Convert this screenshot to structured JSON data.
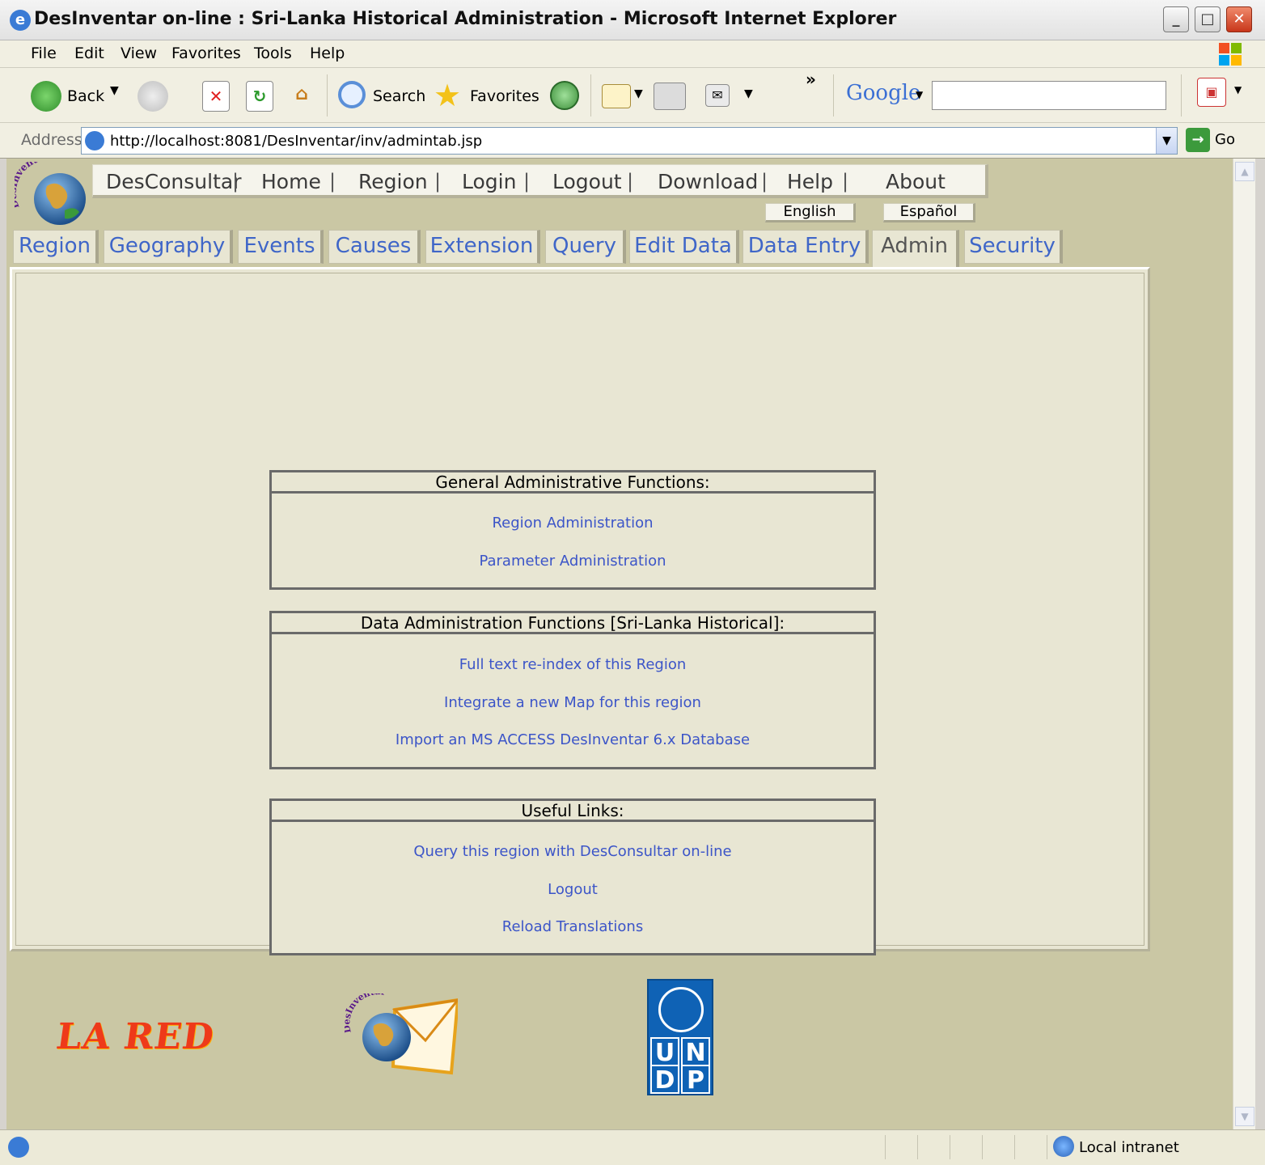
{
  "window": {
    "title": "DesInventar on-line : Sri-Lanka Historical Administration - Microsoft Internet Explorer"
  },
  "menu": [
    "File",
    "Edit",
    "View",
    "Favorites",
    "Tools",
    "Help"
  ],
  "toolbar": {
    "back": "Back",
    "search": "Search",
    "favorites": "Favorites",
    "google": "Google",
    "more": "»"
  },
  "address": {
    "label": "Address",
    "url": "http://localhost:8081/DesInventar/inv/admintab.jsp",
    "go": "Go"
  },
  "app": {
    "logo_text": "DesInventar",
    "topnav": [
      "DesConsultar",
      "Home",
      "Region",
      "Login",
      "Logout",
      "Download",
      "Help",
      "About"
    ],
    "languages": [
      "English",
      "Español"
    ],
    "tabs": [
      "Region",
      "Geography",
      "Events",
      "Causes",
      "Extension",
      "Query",
      "Edit Data",
      "Data Entry",
      "Admin",
      "Security"
    ],
    "active_tab": "Admin"
  },
  "sections": {
    "general": {
      "title": "General Administrative Functions:",
      "links": [
        "Region Administration",
        "Parameter Administration"
      ]
    },
    "data": {
      "title": "Data Administration Functions [Sri-Lanka Historical]:",
      "links": [
        "Full text re-index of this Region",
        "Integrate a new Map for this region",
        "Import an MS ACCESS DesInventar 6.x Database"
      ]
    },
    "useful": {
      "title": "Useful Links:",
      "links": [
        "Query this region with DesConsultar on-line",
        "Logout",
        "Reload Translations"
      ]
    }
  },
  "footer": {
    "lared": "LA RED",
    "envelope_logo_text": "DesInventar",
    "undp_letters": [
      "U",
      "N",
      "D",
      "P"
    ]
  },
  "status": {
    "zone": "Local intranet"
  },
  "colors": {
    "link": "#3c55c8",
    "tab_text": "#3f66c8",
    "page_bg": "#cac7a4",
    "panel_bg": "#e8e6d3"
  }
}
